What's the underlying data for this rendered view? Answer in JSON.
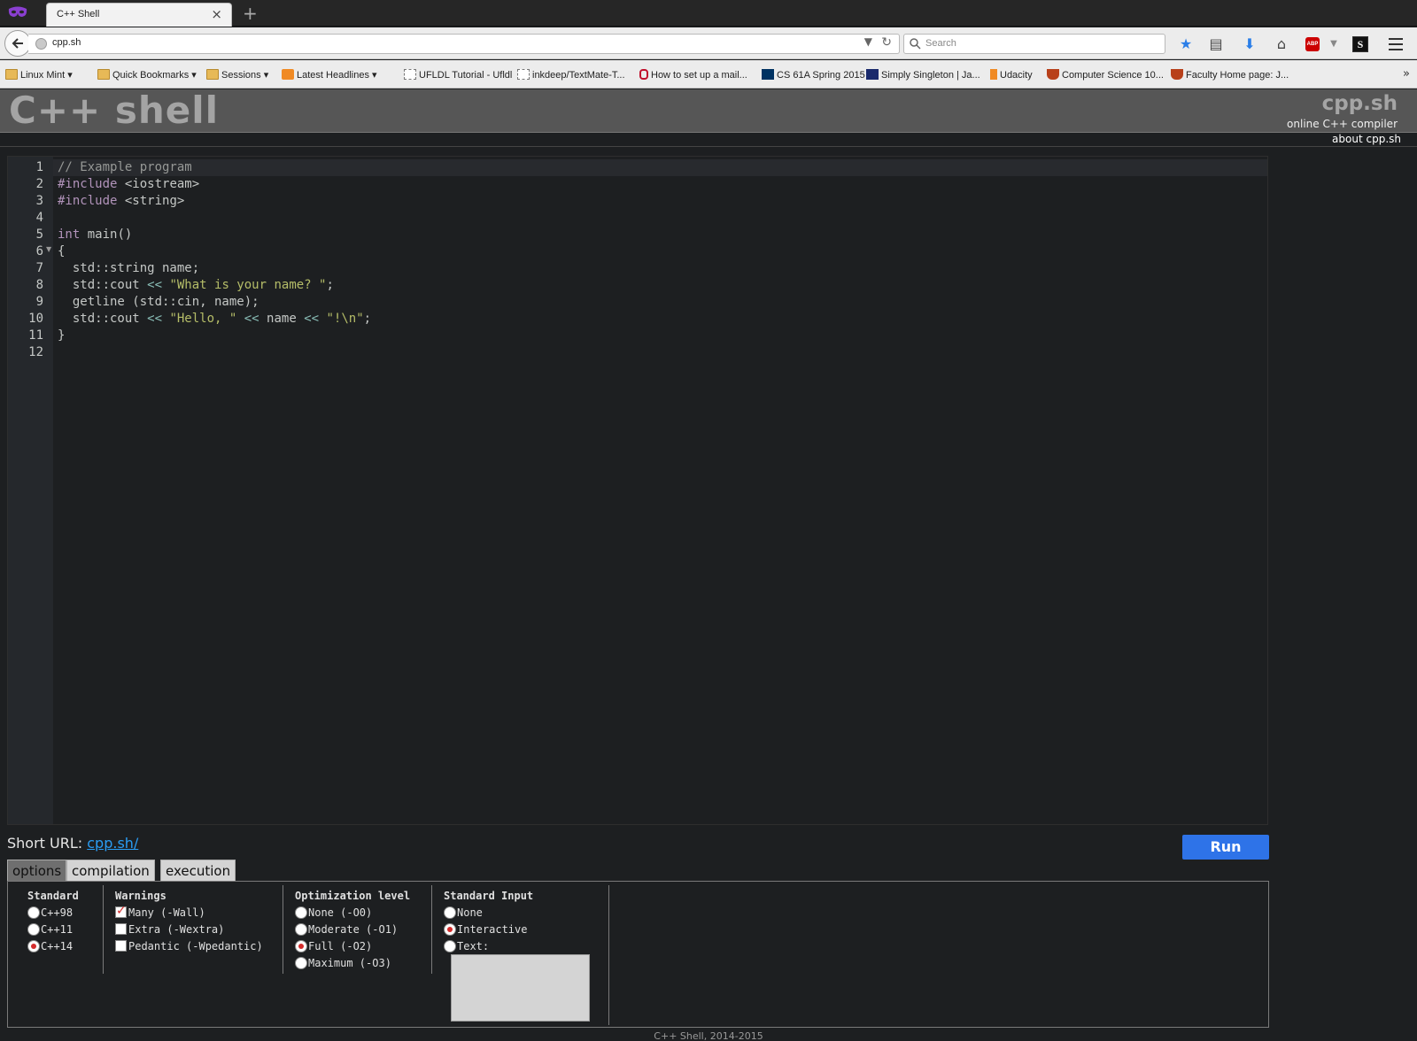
{
  "browser": {
    "tab_title": "C++ Shell",
    "url": "cpp.sh",
    "search_placeholder": "Search",
    "bookmarks": [
      {
        "label": "Linux Mint ▾",
        "icon": "folder-icon"
      },
      {
        "label": "Quick Bookmarks ▾",
        "icon": "folder-icon"
      },
      {
        "label": "Sessions ▾",
        "icon": "folder-icon"
      },
      {
        "label": "Latest Headlines ▾",
        "icon": "rss-icon"
      },
      {
        "label": "UFLDL Tutorial - Ufldl",
        "icon": "page-icon"
      },
      {
        "label": "inkdeep/TextMate-T...",
        "icon": "page-icon"
      },
      {
        "label": "How to set up a mail...",
        "icon": "site-icon"
      },
      {
        "label": "CS 61A Spring 2015",
        "icon": "site-icon"
      },
      {
        "label": "Simply Singleton | Ja...",
        "icon": "site-icon"
      },
      {
        "label": "Udacity",
        "icon": "site-icon"
      },
      {
        "label": "Computer Science 10...",
        "icon": "site-icon"
      },
      {
        "label": "Faculty Home page: J...",
        "icon": "site-icon"
      }
    ]
  },
  "header": {
    "brand": "C++ shell",
    "site_name": "cpp.sh",
    "tagline": "online C++ compiler",
    "about_link": "about cpp.sh"
  },
  "editor": {
    "line_numbers": [
      "1",
      "2",
      "3",
      "4",
      "5",
      "6",
      "7",
      "8",
      "9",
      "10",
      "11",
      "12"
    ]
  },
  "code": {
    "l1": "// Example program",
    "l2_kw": "#include",
    "l2_rest": " <iostream>",
    "l3_kw": "#include",
    "l3_rest": " <string>",
    "l5_kw": "int",
    "l5_rest": " main()",
    "l6": "{",
    "l7": "  std::string name;",
    "l8_a": "  std::cout ",
    "l8_op": "<<",
    "l8_sp": " ",
    "l8_str": "\"What is your name? \"",
    "l8_end": ";",
    "l9": "  getline (std::cin, name);",
    "l10_a": "  std::cout ",
    "l10_op1": "<<",
    "l10_sp1": " ",
    "l10_str1": "\"Hello, \"",
    "l10_sp2": " ",
    "l10_op2": "<<",
    "l10_name": " name ",
    "l10_op3": "<<",
    "l10_sp3": " ",
    "l10_str2": "\"!\\n\"",
    "l10_end": ";",
    "l11": "}"
  },
  "short_url": {
    "label": "Short URL: ",
    "link": "cpp.sh/"
  },
  "run_label": "Run",
  "option_tabs": [
    "options",
    "compilation",
    "execution"
  ],
  "options": {
    "standard": {
      "heading": "Standard",
      "items": [
        {
          "label": "C++98",
          "checked": false
        },
        {
          "label": "C++11",
          "checked": false
        },
        {
          "label": "C++14",
          "checked": true
        }
      ]
    },
    "warnings": {
      "heading": "Warnings",
      "items": [
        {
          "label": "Many (-Wall)",
          "checked": true
        },
        {
          "label": "Extra (-Wextra)",
          "checked": false
        },
        {
          "label": "Pedantic (-Wpedantic)",
          "checked": false
        }
      ]
    },
    "optimization": {
      "heading": "Optimization level",
      "items": [
        {
          "label": "None (-O0)",
          "checked": false
        },
        {
          "label": "Moderate (-O1)",
          "checked": false
        },
        {
          "label": "Full (-O2)",
          "checked": true
        },
        {
          "label": "Maximum (-O3)",
          "checked": false
        }
      ]
    },
    "stdin": {
      "heading": "Standard Input",
      "items": [
        {
          "label": "None",
          "checked": false
        },
        {
          "label": "Interactive",
          "checked": true
        },
        {
          "label": "Text:",
          "checked": false
        }
      ]
    }
  },
  "footer": "C++ Shell, 2014-2015",
  "colors": {
    "run_button": "#2e73e8",
    "editor_bg": "#1d1f21",
    "header_bg": "#565656",
    "keyword": "#b294bb",
    "string": "#b5bd68",
    "operator": "#8abeb7",
    "radio_selected": "#d42c2c"
  }
}
